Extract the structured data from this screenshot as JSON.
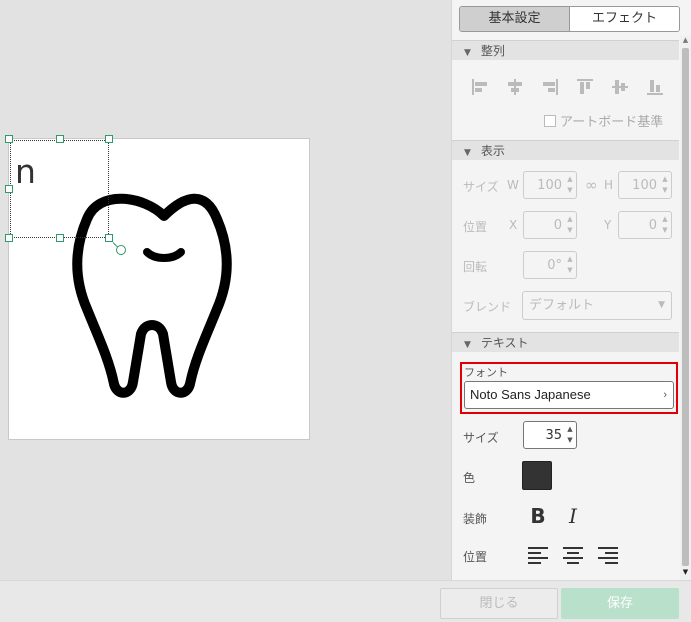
{
  "canvas": {
    "text_layer_text": "n"
  },
  "panel": {
    "tabs": [
      {
        "label": "基本設定",
        "active": true
      },
      {
        "label": "エフェクト",
        "active": false
      }
    ],
    "align_section": {
      "title": "整列",
      "artboard_basis_label": "アートボード基準",
      "artboard_basis_checked": false
    },
    "display_section": {
      "title": "表示",
      "size_label": "サイズ",
      "w_label": "W",
      "w_value": "100",
      "h_label": "H",
      "h_value": "100",
      "position_label": "位置",
      "x_label": "X",
      "x_value": "0",
      "y_label": "Y",
      "y_value": "0",
      "rotation_label": "回転",
      "rotation_value": "0°",
      "blend_label": "ブレンド",
      "blend_value": "デフォルト"
    },
    "text_section": {
      "title": "テキスト",
      "font_label": "フォント",
      "font_value": "Noto Sans Japanese",
      "size_label": "サイズ",
      "size_value": "35",
      "color_label": "色",
      "color_value": "#333333",
      "decoration_label": "装飾",
      "bold_glyph": "B",
      "italic_glyph": "I",
      "position_label": "位置"
    }
  },
  "footer": {
    "close_label": "閉じる",
    "save_label": "保存"
  },
  "colors": {
    "accent_green": "#b8e0cb",
    "selection_green": "#2f9b68",
    "highlight_red": "#e00000"
  }
}
